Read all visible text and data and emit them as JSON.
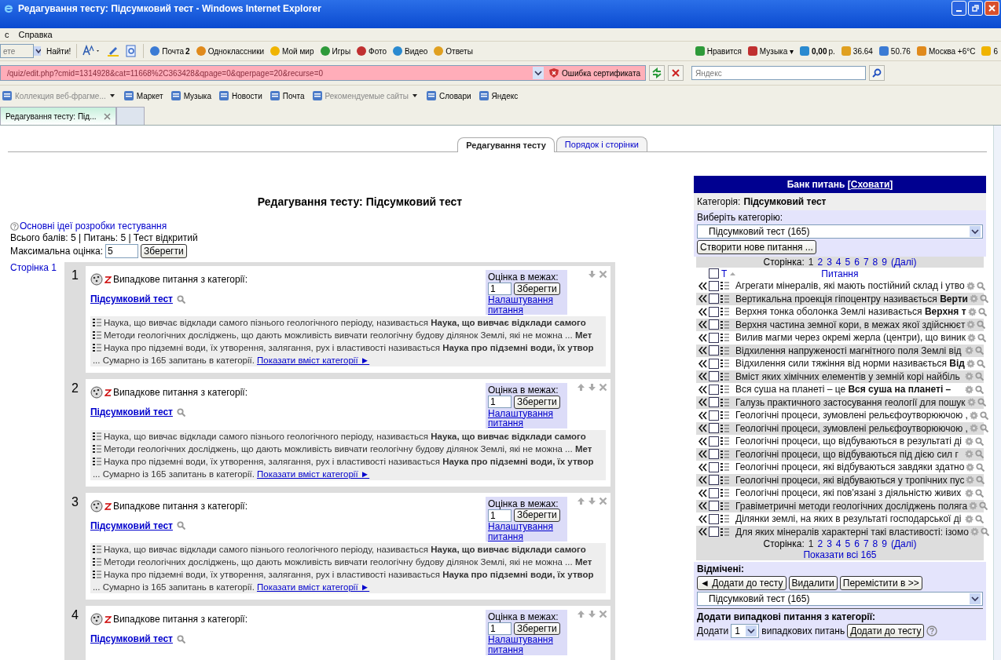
{
  "window": {
    "title": "Редагування тесту: Підсумковий тест - Windows Internet Explorer"
  },
  "menu": [
    "с",
    "Справка"
  ],
  "toolbar": {
    "search_placeholder": "ете",
    "find_button": "Найти!",
    "links": [
      {
        "label": "Почта **2**"
      },
      {
        "label": "Одноклассники"
      },
      {
        "label": "Мой мир"
      },
      {
        "label": "Игры"
      },
      {
        "label": "Фото"
      },
      {
        "label": "Видео"
      },
      {
        "label": "Ответы"
      }
    ],
    "right_items": [
      {
        "label": "Нравится"
      },
      {
        "label": "Музыка ▾"
      },
      {
        "label": "**0,00** р."
      },
      {
        "label": "36.64"
      },
      {
        "label": "50.76"
      },
      {
        "label": "Москва +6°C"
      },
      {
        "label": "6"
      }
    ]
  },
  "address_bar": {
    "url": "/quiz/edit.php?cmid=1314928&cat=11668%2C363428&qpage=0&qperpage=20&recurse=0",
    "certificate_error": "Ошибка сертификата",
    "search_placeholder": "Яндекс"
  },
  "favorites": [
    {
      "label": "Коллекция веб-фрагме...",
      "greyed": true,
      "dropdown": true
    },
    {
      "label": "Маркет",
      "greyed": false,
      "dropdown": false
    },
    {
      "label": "Музыка",
      "greyed": false,
      "dropdown": false
    },
    {
      "label": "Новости",
      "greyed": false,
      "dropdown": false
    },
    {
      "label": "Почта",
      "greyed": false,
      "dropdown": false
    },
    {
      "label": "Рекомендуемые сайты",
      "greyed": true,
      "dropdown": true
    },
    {
      "label": "Словари",
      "greyed": false,
      "dropdown": false
    },
    {
      "label": "Яндекс",
      "greyed": false,
      "dropdown": false
    }
  ],
  "browser_tabs": [
    {
      "label": "Редагування тесту: Під...",
      "selected": true
    }
  ],
  "page_tabs": [
    {
      "label": "Редагування тесту",
      "selected": true
    },
    {
      "label": "Порядок і сторінки",
      "selected": false
    }
  ],
  "heading": "Редагування тесту: Підсумковий тест",
  "help_link": "Основні ідеї розробки тестування",
  "totals": "Всього балів: 5 | Питань: 5 | Тест відкритий",
  "max_grade": {
    "label": "Максимальна оцінка:",
    "value": "5",
    "button": "Зберегти"
  },
  "page_label": "Сторінка 1",
  "questions": [
    {
      "number": "1",
      "heading": "Випадкове питання з категорії:",
      "category": "Підсумковий тест",
      "move_up": false,
      "move_down": true,
      "grade_label": "Оцінка в межах:",
      "grade": "1",
      "save": "Зберегти",
      "settings": "Налаштування питання",
      "previews": [
        "Наука, що вивчає відклади самого пізнього геологічного періоду, називається **Наука, що вивчає відклади самого**",
        "Методи геологічних досліджень, що дають можливість вивчати геологічну будову ділянок Землі, які не можна ... **Мет**",
        "Наука про підземні води, їх утворення, залягання, рух і властивості називається **Наука про підземні води, їх утвор**"
      ],
      "summary": "... Сумарно із 165 запитань в категорії.",
      "show_link": "Показати вміст категорії ►"
    },
    {
      "number": "2",
      "heading": "Випадкове питання з категорії:",
      "category": "Підсумковий тест",
      "move_up": true,
      "move_down": true,
      "grade_label": "Оцінка в межах:",
      "grade": "1",
      "save": "Зберегти",
      "settings": "Налаштування питання",
      "previews": [
        "Наука, що вивчає відклади самого пізнього геологічного періоду, називається **Наука, що вивчає відклади самого**",
        "Методи геологічних досліджень, що дають можливість вивчати геологічну будову ділянок Землі, які не можна ... **Мет**",
        "Наука про підземні води, їх утворення, залягання, рух і властивості називається **Наука про підземні води, їх утвор**"
      ],
      "summary": "... Сумарно із 165 запитань в категорії.",
      "show_link": "Показати вміст категорії ►"
    },
    {
      "number": "3",
      "heading": "Випадкове питання з категорії:",
      "category": "Підсумковий тест",
      "move_up": true,
      "move_down": true,
      "grade_label": "Оцінка в межах:",
      "grade": "1",
      "save": "Зберегти",
      "settings": "Налаштування питання",
      "previews": [
        "Наука, що вивчає відклади самого пізнього геологічного періоду, називається **Наука, що вивчає відклади самого**",
        "Методи геологічних досліджень, що дають можливість вивчати геологічну будову ділянок Землі, які не можна ... **Мет**",
        "Наука про підземні води, їх утворення, залягання, рух і властивості називається **Наука про підземні води, їх утвор**"
      ],
      "summary": "... Сумарно із 165 запитань в категорії.",
      "show_link": "Показати вміст категорії ►"
    },
    {
      "number": "4",
      "heading": "Випадкове питання з категорії:",
      "category": "Підсумковий тест",
      "move_up": true,
      "move_down": true,
      "grade_label": "Оцінка в межах:",
      "grade": "1",
      "save": "Зберегти",
      "settings": "Налаштування питання"
    }
  ],
  "bank": {
    "title": "Банк питань [",
    "hide_link": "Сховати",
    "title_end": "]",
    "category_label": "Категорія:",
    "category": "Підсумковий тест",
    "choose_label": "Виберіть категорію:",
    "choose_value": "Підсумковий тест (165)",
    "create_button": "Створити нове питання ...",
    "pager_label": "Сторінка:",
    "pages": [
      {
        "label": "1",
        "selected": true
      },
      {
        "label": "2",
        "selected": false
      },
      {
        "label": "3",
        "selected": false
      },
      {
        "label": "4",
        "selected": false
      },
      {
        "label": "5",
        "selected": false
      },
      {
        "label": "6",
        "selected": false
      },
      {
        "label": "7",
        "selected": false
      },
      {
        "label": "8",
        "selected": false
      },
      {
        "label": "9",
        "selected": false
      }
    ],
    "next_link": "(Далі)",
    "select_all_checked": false,
    "type_header": "Т",
    "question_header": "Питання",
    "rows": [
      {
        "text": "Агрегати мінералів, які мають постійний склад і утво",
        "checked": false
      },
      {
        "text": "Вертикальна проекція гіпоцентру називається **Верти**",
        "checked": false
      },
      {
        "text": "Верхня тонка оболонка Землі називається **Верхня т**",
        "checked": false
      },
      {
        "text": "Верхня частина земної кори, в межах якої здійснюєт",
        "checked": false
      },
      {
        "text": "Вилив магми через окремі жерла (центри), що виник",
        "checked": false
      },
      {
        "text": "Відхилення напруженості магнітного поля Землі від",
        "checked": false
      },
      {
        "text": "Відхилення сили тяжіння від норми називається **Від**",
        "checked": false
      },
      {
        "text": "Вміст яких хімічних елементів у земній корі найбіль",
        "checked": false
      },
      {
        "text": "Вся суша на планеті – це **Вся суша на планеті –**",
        "checked": false
      },
      {
        "text": "Галузь практичного застосування геології для пошук",
        "checked": false
      },
      {
        "text": "Геологічні процеси, зумовлені рельєфоутворюючою ,",
        "checked": false
      },
      {
        "text": "Геологічні процеси, зумовлені рельєфоутворюючою ,",
        "checked": false
      },
      {
        "text": "Геологічні процеси, що відбуваються в результаті ді",
        "checked": false
      },
      {
        "text": "Геологічні процеси, що відбуваються під дією сил г",
        "checked": false
      },
      {
        "text": "Геологічні процеси, які відбуваються завдяки здатно",
        "checked": false
      },
      {
        "text": "Геологічні процеси, які відбуваються у тропічних пус",
        "checked": false
      },
      {
        "text": "Геологічні процеси, які пов'язані з діяльністю живих",
        "checked": false
      },
      {
        "text": "Гравіметричні методи геологічних досліджень поляга",
        "checked": false
      },
      {
        "text": "Ділянки землі, на яких в результаті господарської ді",
        "checked": false
      },
      {
        "text": "Для яких мінералів характерні такі властивості: ізомо",
        "checked": false
      }
    ],
    "pager_bottom": {
      "label": "Сторінка:",
      "pages": [
        {
          "label": "1",
          "selected": true
        },
        {
          "label": "2",
          "selected": false
        },
        {
          "label": "3",
          "selected": false
        },
        {
          "label": "4",
          "selected": false
        },
        {
          "label": "5",
          "selected": false
        },
        {
          "label": "6",
          "selected": false
        },
        {
          "label": "7",
          "selected": false
        },
        {
          "label": "8",
          "selected": false
        },
        {
          "label": "9",
          "selected": false
        }
      ],
      "next_link": "(Далі)"
    },
    "show_all": "Показати всі 165",
    "selected_label": "Відмічені:",
    "add_button": "◄ Додати до тесту",
    "delete_button": "Видалити",
    "move_button": "Перемістити в >>",
    "move_target": "Підсумковий тест (165)",
    "random_label": "Додати випадкові питання з категорії:",
    "random_add": "Додати",
    "random_count": "1",
    "random_suffix": "випадкових питань",
    "random_button": "Додати до тесту"
  }
}
